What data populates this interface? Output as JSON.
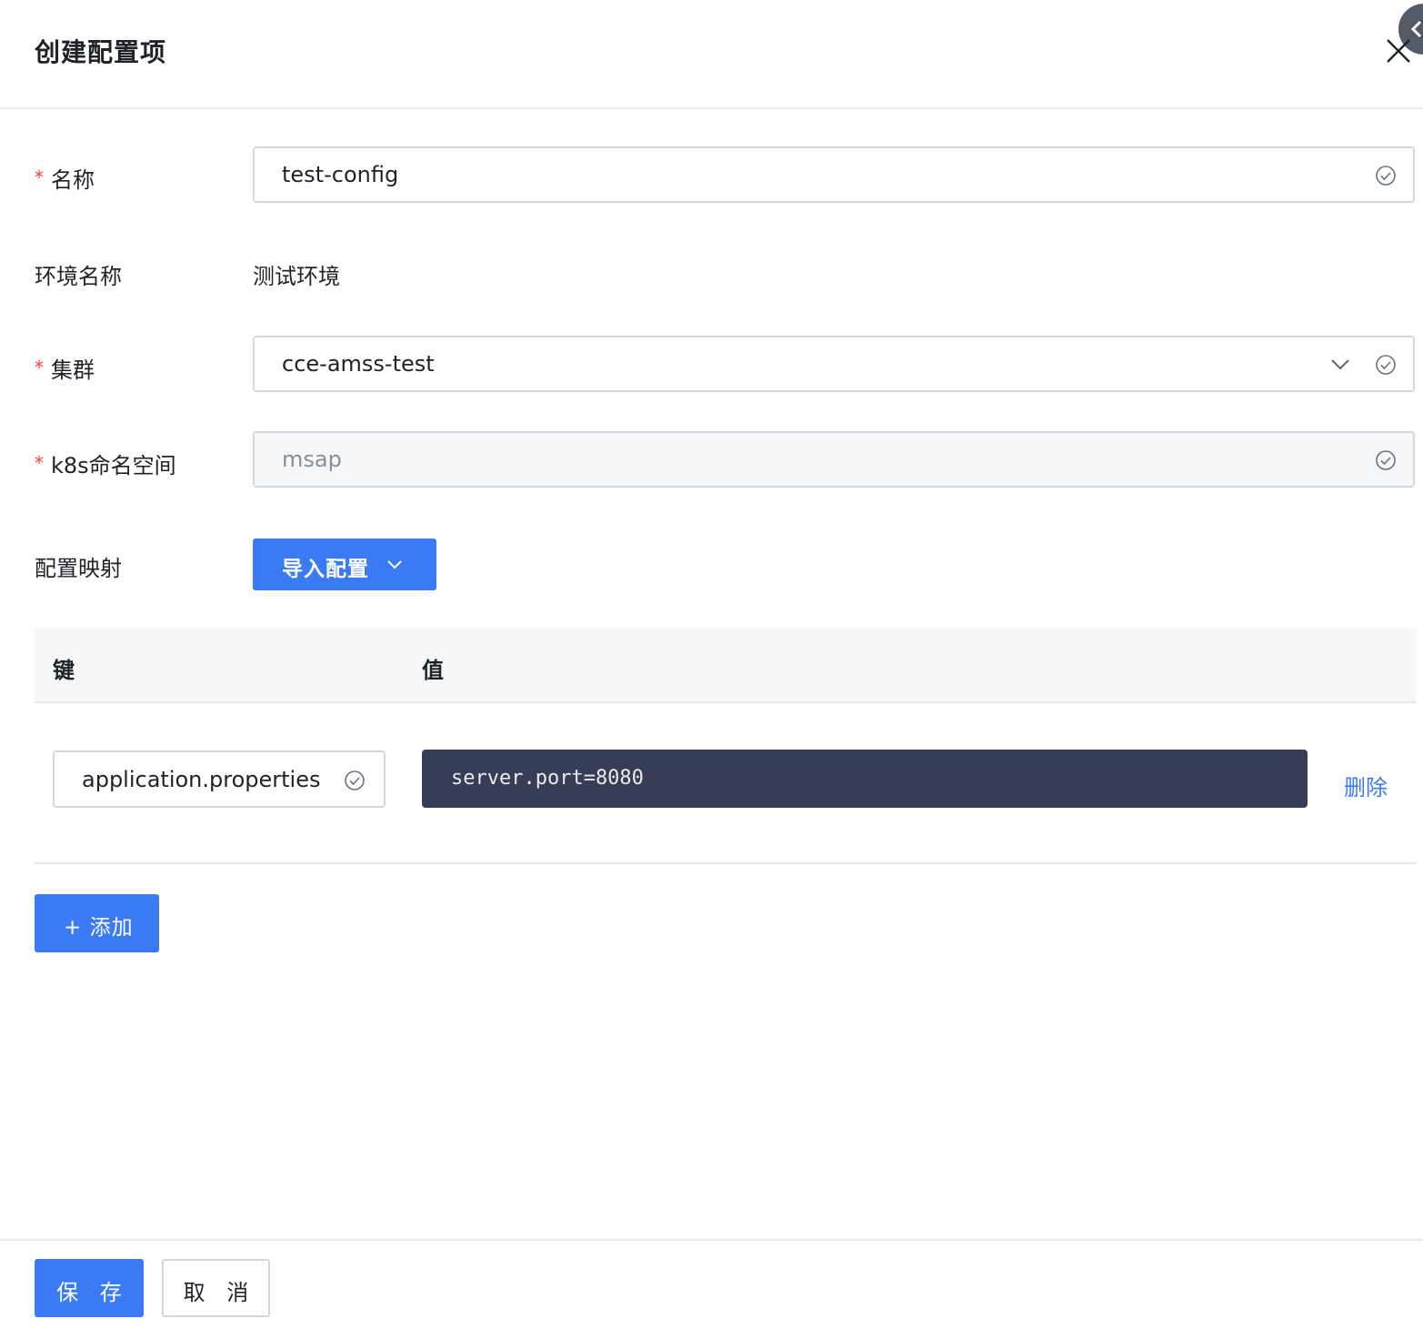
{
  "dialog": {
    "title": "创建配置项"
  },
  "form": {
    "name": {
      "label": "名称",
      "required_mark": "*",
      "value": "test-config"
    },
    "env": {
      "label": "环境名称",
      "value": "测试环境"
    },
    "cluster": {
      "label": "集群",
      "required_mark": "*",
      "value": "cce-amss-test"
    },
    "namespace": {
      "label": "k8s命名空间",
      "required_mark": "*",
      "value": "msap"
    },
    "config_map": {
      "label": "配置映射",
      "import_button": "导入配置"
    }
  },
  "table": {
    "headers": {
      "key": "键",
      "value": "值"
    },
    "rows": [
      {
        "key": "application.properties",
        "value": "server.port=8080",
        "action": "删除"
      }
    ],
    "add_button": "+ 添加"
  },
  "footer": {
    "save": "保 存",
    "cancel": "取 消"
  },
  "colors": {
    "primary": "#3a7bf5",
    "required": "#f53f3f",
    "editor_bg": "#363e55"
  }
}
